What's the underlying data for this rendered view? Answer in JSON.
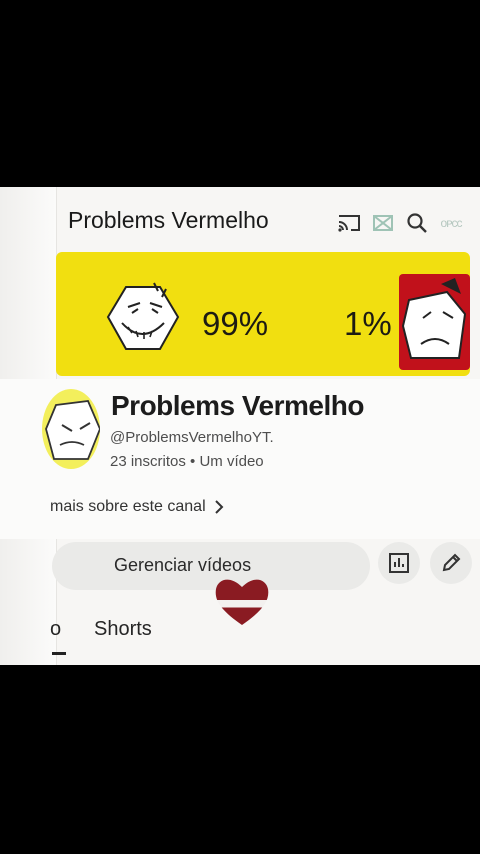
{
  "header": {
    "title": "Problems Vermelho",
    "icons": [
      "cast-icon",
      "notifications-icon",
      "search-icon",
      "more-icon"
    ],
    "overlay_glyph_text": "ᴏᴘᴄᴄ"
  },
  "banner": {
    "background_color": "#f1df10",
    "left_percent": "99%",
    "right_percent": "1%",
    "accent_color": "#c1111b"
  },
  "channel": {
    "name": "Problems Vermelho",
    "handle": "@ProblemsVermelhoYT.",
    "stats": "23 inscritos • Um vídeo",
    "about_link": "mais sobre este canal"
  },
  "actions": {
    "manage_videos": "Gerenciar vídeos"
  },
  "tabs": [
    {
      "label": "o"
    },
    {
      "label": "Shorts"
    }
  ]
}
